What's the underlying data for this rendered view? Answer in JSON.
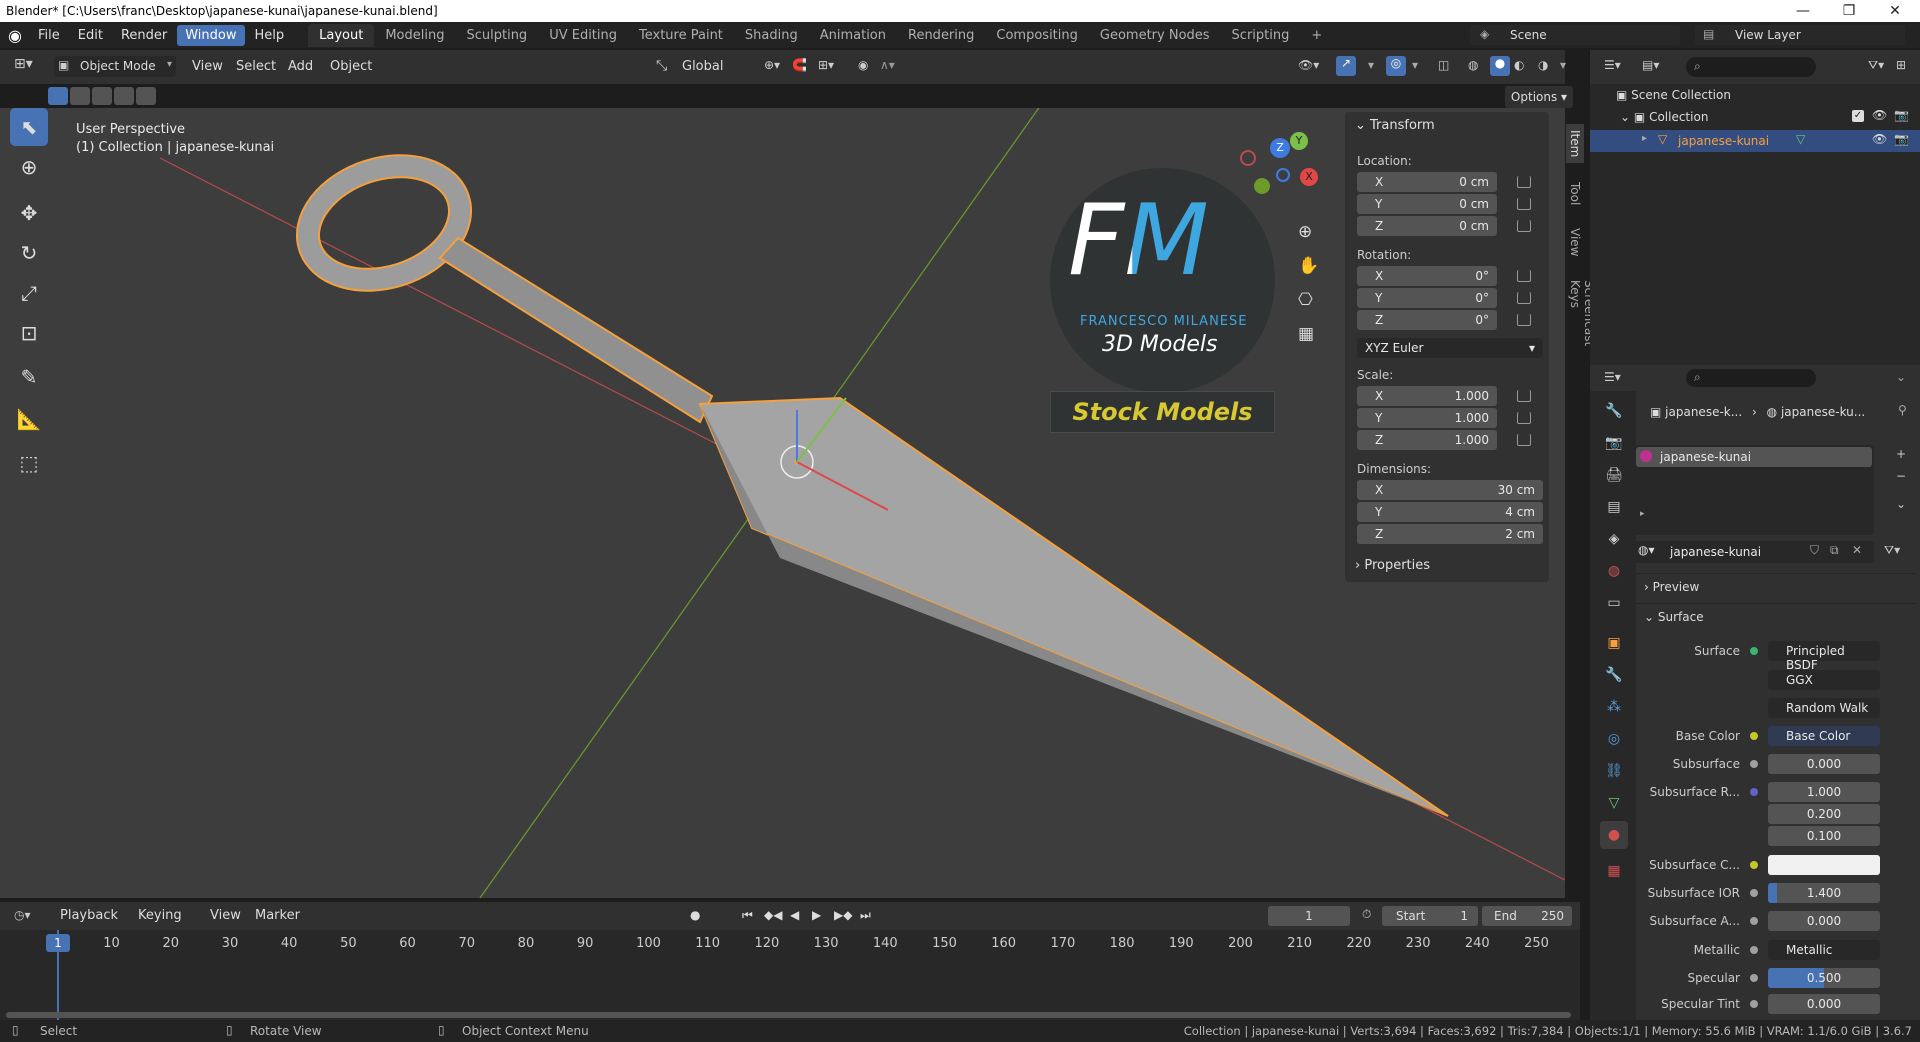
{
  "window": {
    "title": "Blender* [C:\\Users\\franc\\Desktop\\japanese-kunai\\japanese-kunai.blend]"
  },
  "menus": [
    "File",
    "Edit",
    "Render",
    "Window",
    "Help"
  ],
  "workspaces": [
    "Layout",
    "Modeling",
    "Sculpting",
    "UV Editing",
    "Texture Paint",
    "Shading",
    "Animation",
    "Rendering",
    "Compositing",
    "Geometry Nodes",
    "Scripting"
  ],
  "scene": {
    "name": "Scene",
    "view_layer": "View Layer"
  },
  "viewport": {
    "mode": "Object Mode",
    "menus": [
      "View",
      "Select",
      "Add",
      "Object"
    ],
    "orientation": "Global",
    "options": "Options",
    "overlay_title": "User Perspective",
    "overlay_sub": "(1) Collection | japanese-kunai",
    "logo_big": "FM",
    "logo_name": "FRANCESCO MILANESE",
    "logo_3d": "3D Models",
    "stock": "Stock Models"
  },
  "side_tabs": [
    "Item",
    "Tool",
    "View",
    "Screencast Keys"
  ],
  "transform": {
    "title": "Transform",
    "location_label": "Location:",
    "location": [
      {
        "axis": "X",
        "value": "0 cm"
      },
      {
        "axis": "Y",
        "value": "0 cm"
      },
      {
        "axis": "Z",
        "value": "0 cm"
      }
    ],
    "rotation_label": "Rotation:",
    "rotation": [
      {
        "axis": "X",
        "value": "0°"
      },
      {
        "axis": "Y",
        "value": "0°"
      },
      {
        "axis": "Z",
        "value": "0°"
      }
    ],
    "rotation_mode": "XYZ Euler",
    "scale_label": "Scale:",
    "scale": [
      {
        "axis": "X",
        "value": "1.000"
      },
      {
        "axis": "Y",
        "value": "1.000"
      },
      {
        "axis": "Z",
        "value": "1.000"
      }
    ],
    "dimensions_label": "Dimensions:",
    "dimensions": [
      {
        "axis": "X",
        "value": "30 cm"
      },
      {
        "axis": "Y",
        "value": "4 cm"
      },
      {
        "axis": "Z",
        "value": "2 cm"
      }
    ],
    "properties": "Properties"
  },
  "outliner": {
    "scene_collection": "Scene Collection",
    "collection": "Collection",
    "object": "japanese-kunai"
  },
  "properties": {
    "breadcrumb_obj": "japanese-k...",
    "breadcrumb_mat": "japanese-ku...",
    "slot": "japanese-kunai",
    "material": "japanese-kunai",
    "preview": "Preview",
    "surface_section": "Surface",
    "rows": [
      {
        "label": "Surface",
        "value": "Principled BSDF",
        "dot": "#3cb371"
      },
      {
        "label": "",
        "value": "GGX"
      },
      {
        "label": "",
        "value": "Random Walk"
      },
      {
        "label": "Base Color",
        "value": "Base Color",
        "dot": "#c7c729"
      },
      {
        "label": "Subsurface",
        "value": "0.000",
        "dot": "#a0a0a0"
      },
      {
        "label": "Subsurface R...",
        "value": "1.000",
        "dot": "#6363c7"
      },
      {
        "label": "",
        "value": "0.200"
      },
      {
        "label": "",
        "value": "0.100"
      },
      {
        "label": "Subsurface C...",
        "value": "",
        "dot": "#c7c729"
      },
      {
        "label": "Subsurface IOR",
        "value": "1.400",
        "dot": "#a0a0a0"
      },
      {
        "label": "Subsurface A...",
        "value": "0.000",
        "dot": "#a0a0a0"
      },
      {
        "label": "Metallic",
        "value": "Metallic",
        "dot": "#a0a0a0"
      },
      {
        "label": "Specular",
        "value": "0.500",
        "dot": "#a0a0a0"
      },
      {
        "label": "Specular Tint",
        "value": "0.000",
        "dot": "#a0a0a0"
      }
    ]
  },
  "timeline": {
    "menus": [
      "Playback",
      "Keying",
      "View",
      "Marker"
    ],
    "current": "1",
    "start_label": "Start",
    "start": "1",
    "end_label": "End",
    "end": "250",
    "ticks": [
      "1",
      "10",
      "20",
      "30",
      "40",
      "50",
      "60",
      "70",
      "80",
      "90",
      "100",
      "110",
      "120",
      "130",
      "140",
      "150",
      "160",
      "170",
      "180",
      "190",
      "200",
      "210",
      "220",
      "230",
      "240",
      "250"
    ]
  },
  "status": {
    "select": "Select",
    "rotate": "Rotate View",
    "context": "Object Context Menu",
    "stats": "Collection | japanese-kunai | Verts:3,694 | Faces:3,692 | Tris:7,384 | Objects:1/1 | Memory: 55.6 MiB | VRAM: 1.1/6.0 GiB | 3.6.7"
  }
}
